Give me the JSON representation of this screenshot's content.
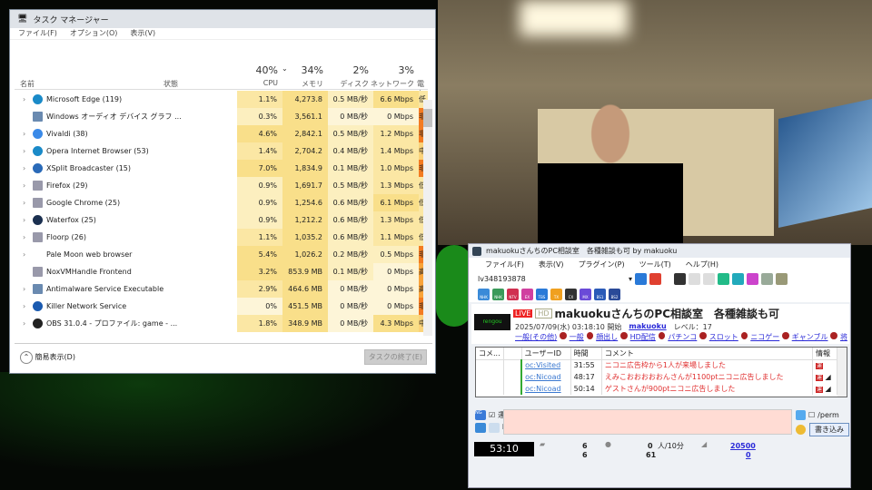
{
  "task_manager": {
    "title": "タスク マネージャー",
    "menu": [
      "ファイル(F)",
      "オプション(O)",
      "表示(V)"
    ],
    "columns": {
      "name": "名前",
      "status": "状態",
      "cpu": "CPU",
      "cpu_pct": "40%",
      "memory": "メモリ",
      "memory_pct": "34%",
      "disk": "ディスク",
      "disk_pct": "2%",
      "network": "ネットワーク",
      "network_pct": "3%",
      "power": "電力"
    },
    "rows": [
      {
        "name": "Microsoft Edge (119)",
        "cpu": "1.1%",
        "mem": "4,273.8 MB",
        "disk": "0.5 MB/秒",
        "net": "6.6 Mbps",
        "power": "低",
        "icon": "edge-icon",
        "expand": true
      },
      {
        "name": "Windows オーディオ デバイス グラフ ...",
        "cpu": "0.3%",
        "mem": "3,561.1 MB",
        "disk": "0 MB/秒",
        "net": "0 Mbps",
        "power": "非",
        "icon": "service-icon",
        "expand": false
      },
      {
        "name": "Vivaldi (38)",
        "cpu": "4.6%",
        "mem": "2,842.1 MB",
        "disk": "0.5 MB/秒",
        "net": "1.2 Mbps",
        "power": "非",
        "icon": "vivaldi-icon",
        "expand": true
      },
      {
        "name": "Opera Internet Browser (53)",
        "cpu": "1.4%",
        "mem": "2,704.2 MB",
        "disk": "0.4 MB/秒",
        "net": "1.4 Mbps",
        "power": "中",
        "icon": "edge-icon",
        "expand": true
      },
      {
        "name": "XSplit Broadcaster (15)",
        "cpu": "7.0%",
        "mem": "1,834.9 MB",
        "disk": "0.1 MB/秒",
        "net": "1.0 Mbps",
        "power": "非",
        "icon": "xsplit-icon",
        "expand": true
      },
      {
        "name": "Firefox (29)",
        "cpu": "0.9%",
        "mem": "1,691.7 MB",
        "disk": "0.5 MB/秒",
        "net": "1.3 Mbps",
        "power": "低",
        "icon": "app-window-icon",
        "expand": true
      },
      {
        "name": "Google Chrome (25)",
        "cpu": "0.9%",
        "mem": "1,254.6 MB",
        "disk": "0.6 MB/秒",
        "net": "6.1 Mbps",
        "power": "低",
        "icon": "app-window-icon",
        "expand": true
      },
      {
        "name": "Waterfox (25)",
        "cpu": "0.9%",
        "mem": "1,212.2 MB",
        "disk": "0.6 MB/秒",
        "net": "1.3 Mbps",
        "power": "低",
        "icon": "steam-icon",
        "expand": true
      },
      {
        "name": "Floorp (26)",
        "cpu": "1.1%",
        "mem": "1,035.2 MB",
        "disk": "0.6 MB/秒",
        "net": "1.1 Mbps",
        "power": "低",
        "icon": "app-window-icon",
        "expand": true
      },
      {
        "name": "Pale Moon web browser",
        "cpu": "5.4%",
        "mem": "1,026.2 MB",
        "disk": "0.2 MB/秒",
        "net": "0.5 Mbps",
        "power": "非",
        "icon": "none",
        "expand": true
      },
      {
        "name": "NoxVMHandle Frontend",
        "cpu": "3.2%",
        "mem": "853.9 MB",
        "disk": "0.1 MB/秒",
        "net": "0 Mbps",
        "power": "高",
        "icon": "app-window-icon",
        "expand": false
      },
      {
        "name": "Antimalware Service Executable",
        "cpu": "2.9%",
        "mem": "464.6 MB",
        "disk": "0 MB/秒",
        "net": "0 Mbps",
        "power": "高",
        "icon": "service-icon",
        "expand": true
      },
      {
        "name": "Killer Network Service",
        "cpu": "0%",
        "mem": "451.5 MB",
        "disk": "0 MB/秒",
        "net": "0 Mbps",
        "power": "非",
        "icon": "killer-icon",
        "expand": true
      },
      {
        "name": "OBS 31.0.4 - プロファイル: game - ...",
        "cpu": "1.8%",
        "mem": "348.9 MB",
        "disk": "0 MB/秒",
        "net": "4.3 Mbps",
        "power": "中",
        "icon": "obs-icon",
        "expand": true
      }
    ],
    "fewer_details": "簡易表示(D)",
    "end_task": "タスクの終了(E)"
  },
  "nico": {
    "title": "makuokuさんちのPC相談室　各種雑談も可 by makuoku",
    "menu": [
      "ファイル(F)",
      "表示(V)",
      "プラグイン(P)",
      "ツール(T)",
      "ヘルプ(H)"
    ],
    "live_id": "lv348193878",
    "channels": [
      "NHK",
      "NHK",
      "NTV",
      "EX",
      "TBS",
      "TX",
      "CX",
      "MX",
      "BS1",
      "BS2"
    ],
    "live_badge": "LIVE",
    "hd_badge": "HD",
    "stream_title": "makuokuさんちのPC相談室　各種雑談も可",
    "start": "2025/07/09(水) 03:18:10 開始",
    "owner": "makuoku",
    "level": "レベル：17",
    "tags": [
      "一般(その他)",
      "一般",
      "顔出し",
      "HD配信",
      "パチンコ",
      "スロット",
      "ニコゲー",
      "ギャンブル",
      "将"
    ],
    "comment_headers": [
      "コメ...",
      "",
      "ユーザーID",
      "時間",
      "コメント",
      "情報"
    ],
    "comments": [
      {
        "user": "oc:Visited",
        "time": "31:55",
        "text": "ニコニ広告枠から1人が来場しました",
        "info": "運"
      },
      {
        "user": "oc:Nicoad",
        "time": "48:17",
        "text": "えみこおおおおおんさんが1100ptニコニ広告しました",
        "info": "運"
      },
      {
        "user": "oc:Nicoad",
        "time": "50:14",
        "text": "ゲストさんが900ptニコニ広告しました",
        "info": "運"
      }
    ],
    "ng": "NG",
    "unei": "運営",
    "perm": "/perm",
    "post": "書き込み",
    "timer": "53:10",
    "stats": {
      "comments": "6",
      "comments2": "6",
      "visitors_rate": "0",
      "rate_unit": "人/10分",
      "viewers": "61",
      "ad_points": "20500",
      "gifts": "0"
    }
  }
}
